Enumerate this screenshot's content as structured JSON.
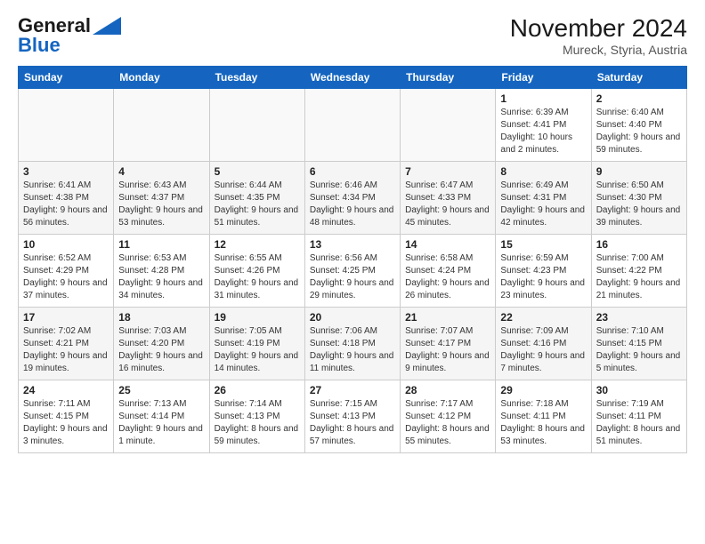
{
  "logo": {
    "general": "General",
    "blue": "Blue"
  },
  "header": {
    "month_year": "November 2024",
    "location": "Mureck, Styria, Austria"
  },
  "days_of_week": [
    "Sunday",
    "Monday",
    "Tuesday",
    "Wednesday",
    "Thursday",
    "Friday",
    "Saturday"
  ],
  "weeks": [
    [
      {
        "day": "",
        "info": ""
      },
      {
        "day": "",
        "info": ""
      },
      {
        "day": "",
        "info": ""
      },
      {
        "day": "",
        "info": ""
      },
      {
        "day": "",
        "info": ""
      },
      {
        "day": "1",
        "info": "Sunrise: 6:39 AM\nSunset: 4:41 PM\nDaylight: 10 hours and 2 minutes."
      },
      {
        "day": "2",
        "info": "Sunrise: 6:40 AM\nSunset: 4:40 PM\nDaylight: 9 hours and 59 minutes."
      }
    ],
    [
      {
        "day": "3",
        "info": "Sunrise: 6:41 AM\nSunset: 4:38 PM\nDaylight: 9 hours and 56 minutes."
      },
      {
        "day": "4",
        "info": "Sunrise: 6:43 AM\nSunset: 4:37 PM\nDaylight: 9 hours and 53 minutes."
      },
      {
        "day": "5",
        "info": "Sunrise: 6:44 AM\nSunset: 4:35 PM\nDaylight: 9 hours and 51 minutes."
      },
      {
        "day": "6",
        "info": "Sunrise: 6:46 AM\nSunset: 4:34 PM\nDaylight: 9 hours and 48 minutes."
      },
      {
        "day": "7",
        "info": "Sunrise: 6:47 AM\nSunset: 4:33 PM\nDaylight: 9 hours and 45 minutes."
      },
      {
        "day": "8",
        "info": "Sunrise: 6:49 AM\nSunset: 4:31 PM\nDaylight: 9 hours and 42 minutes."
      },
      {
        "day": "9",
        "info": "Sunrise: 6:50 AM\nSunset: 4:30 PM\nDaylight: 9 hours and 39 minutes."
      }
    ],
    [
      {
        "day": "10",
        "info": "Sunrise: 6:52 AM\nSunset: 4:29 PM\nDaylight: 9 hours and 37 minutes."
      },
      {
        "day": "11",
        "info": "Sunrise: 6:53 AM\nSunset: 4:28 PM\nDaylight: 9 hours and 34 minutes."
      },
      {
        "day": "12",
        "info": "Sunrise: 6:55 AM\nSunset: 4:26 PM\nDaylight: 9 hours and 31 minutes."
      },
      {
        "day": "13",
        "info": "Sunrise: 6:56 AM\nSunset: 4:25 PM\nDaylight: 9 hours and 29 minutes."
      },
      {
        "day": "14",
        "info": "Sunrise: 6:58 AM\nSunset: 4:24 PM\nDaylight: 9 hours and 26 minutes."
      },
      {
        "day": "15",
        "info": "Sunrise: 6:59 AM\nSunset: 4:23 PM\nDaylight: 9 hours and 23 minutes."
      },
      {
        "day": "16",
        "info": "Sunrise: 7:00 AM\nSunset: 4:22 PM\nDaylight: 9 hours and 21 minutes."
      }
    ],
    [
      {
        "day": "17",
        "info": "Sunrise: 7:02 AM\nSunset: 4:21 PM\nDaylight: 9 hours and 19 minutes."
      },
      {
        "day": "18",
        "info": "Sunrise: 7:03 AM\nSunset: 4:20 PM\nDaylight: 9 hours and 16 minutes."
      },
      {
        "day": "19",
        "info": "Sunrise: 7:05 AM\nSunset: 4:19 PM\nDaylight: 9 hours and 14 minutes."
      },
      {
        "day": "20",
        "info": "Sunrise: 7:06 AM\nSunset: 4:18 PM\nDaylight: 9 hours and 11 minutes."
      },
      {
        "day": "21",
        "info": "Sunrise: 7:07 AM\nSunset: 4:17 PM\nDaylight: 9 hours and 9 minutes."
      },
      {
        "day": "22",
        "info": "Sunrise: 7:09 AM\nSunset: 4:16 PM\nDaylight: 9 hours and 7 minutes."
      },
      {
        "day": "23",
        "info": "Sunrise: 7:10 AM\nSunset: 4:15 PM\nDaylight: 9 hours and 5 minutes."
      }
    ],
    [
      {
        "day": "24",
        "info": "Sunrise: 7:11 AM\nSunset: 4:15 PM\nDaylight: 9 hours and 3 minutes."
      },
      {
        "day": "25",
        "info": "Sunrise: 7:13 AM\nSunset: 4:14 PM\nDaylight: 9 hours and 1 minute."
      },
      {
        "day": "26",
        "info": "Sunrise: 7:14 AM\nSunset: 4:13 PM\nDaylight: 8 hours and 59 minutes."
      },
      {
        "day": "27",
        "info": "Sunrise: 7:15 AM\nSunset: 4:13 PM\nDaylight: 8 hours and 57 minutes."
      },
      {
        "day": "28",
        "info": "Sunrise: 7:17 AM\nSunset: 4:12 PM\nDaylight: 8 hours and 55 minutes."
      },
      {
        "day": "29",
        "info": "Sunrise: 7:18 AM\nSunset: 4:11 PM\nDaylight: 8 hours and 53 minutes."
      },
      {
        "day": "30",
        "info": "Sunrise: 7:19 AM\nSunset: 4:11 PM\nDaylight: 8 hours and 51 minutes."
      }
    ]
  ]
}
